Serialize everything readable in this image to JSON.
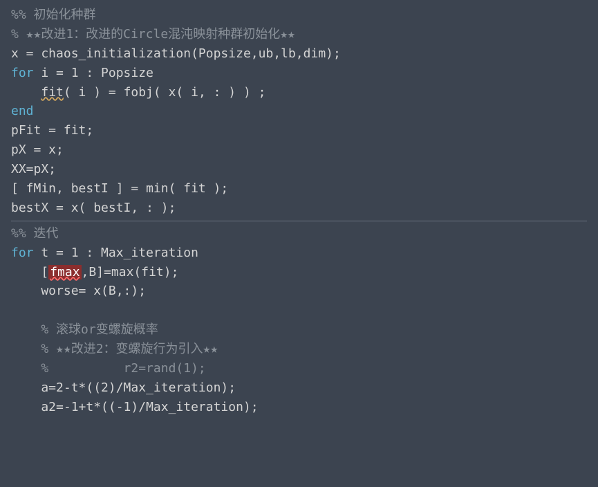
{
  "lines": {
    "l1": "%% 初始化种群",
    "l2": "% ★★改进1：改进的Circle混沌映射种群初始化★★",
    "l3_a": "x = chaos_initialization(Popsize,ub,lb,dim);",
    "l4_for": "for",
    "l4_rest": " i = 1 : Popsize",
    "l5_indent": "    ",
    "l5_fit": "fit",
    "l5_rest": "( i ) = fobj( x( i, : ) ) ;",
    "l6_end": "end",
    "l7": "pFit = fit;",
    "l8": "pX = x;",
    "l9": "XX=pX;",
    "l10": "[ fMin, bestI ] = min( fit );",
    "l11": "bestX = x( bestI, : );",
    "l12": "%% 迭代",
    "l13_for": "for",
    "l13_rest": " t = 1 : Max_iteration",
    "l14_indent": "    [",
    "l14_fmax": "fmax",
    "l14_rest": ",B]=max(fit);",
    "l15": "    worse= x(B,:);",
    "l16": "    ",
    "l17": "    % 滚球or变螺旋概率",
    "l18": "    % ★★改进2：变螺旋行为引入★★",
    "l19": "    %          r2=rand(1);",
    "l20": "    a=2-t*((2)/Max_iteration);",
    "l21": "    a2=-1+t*((-1)/Max_iteration);"
  }
}
